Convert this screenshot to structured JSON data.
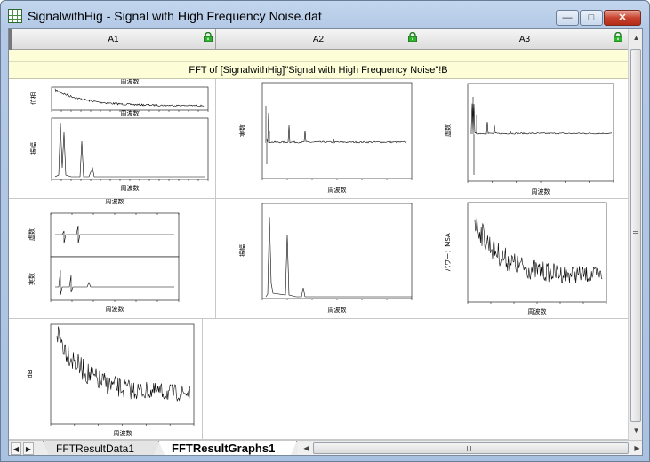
{
  "window": {
    "title": "SignalwithHig - Signal with High Frequency Noise.dat",
    "min_label": "—",
    "max_label": "□",
    "close_label": "✕"
  },
  "columns": [
    {
      "label": "A1"
    },
    {
      "label": "A2"
    },
    {
      "label": "A3"
    }
  ],
  "long_name": "FFT of [SignalwithHig]\"Signal with High Frequency Noise\"!B",
  "graphs": {
    "g11": {
      "xlabel": "周波数",
      "ylabel_top": "位相",
      "ylabel_bottom": "振幅",
      "xlabel_top": "周波数"
    },
    "g12": {
      "xlabel": "周波数",
      "ylabel": "実数"
    },
    "g13": {
      "xlabel": "周波数",
      "ylabel": "虚数"
    },
    "g21": {
      "xlabel": "周波数",
      "ylabel_top": "虚数",
      "ylabel_bottom": "実数"
    },
    "g22": {
      "xlabel": "周波数",
      "ylabel": "振幅"
    },
    "g23": {
      "xlabel": "周波数",
      "ylabel": "パワー：MSA"
    },
    "g31": {
      "xlabel": "周波数",
      "ylabel": "dB"
    }
  },
  "tabs": [
    {
      "label": "FFTResultData1",
      "active": false
    },
    {
      "label": "FFTResultGraphs1",
      "active": true
    }
  ],
  "colors": {
    "lock": "#1a9a1a",
    "label_row": "#fdfdd8",
    "close_button": "#c7432f"
  }
}
